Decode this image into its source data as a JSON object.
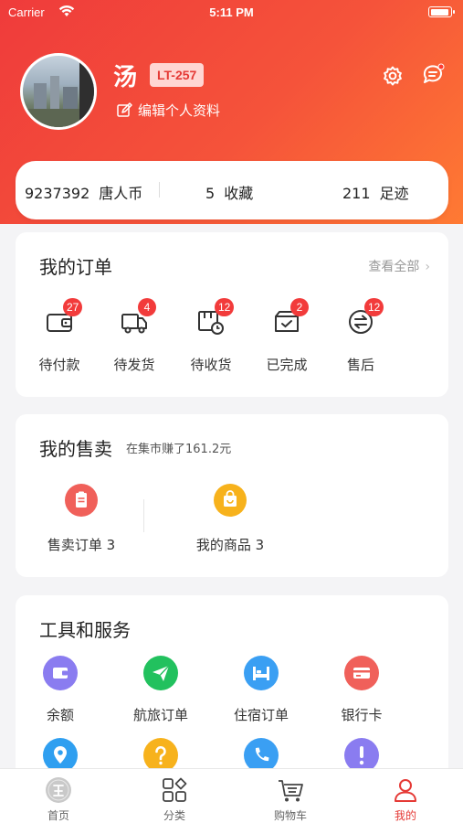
{
  "status_bar": {
    "carrier": "Carrier",
    "time": "5:11 PM"
  },
  "profile": {
    "name": "汤",
    "tag": "LT-257",
    "edit_label": "编辑个人资料"
  },
  "stats": [
    {
      "value": "9237392",
      "label": "唐人币"
    },
    {
      "value": "5",
      "label": "收藏"
    },
    {
      "value": "211",
      "label": "足迹"
    }
  ],
  "orders": {
    "title": "我的订单",
    "view_all": "查看全部",
    "items": [
      {
        "label": "待付款",
        "badge": "27",
        "icon": "wallet-icon"
      },
      {
        "label": "待发货",
        "badge": "4",
        "icon": "truck-icon"
      },
      {
        "label": "待收货",
        "badge": "12",
        "icon": "package-clock-icon"
      },
      {
        "label": "已完成",
        "badge": "2",
        "icon": "box-check-icon"
      },
      {
        "label": "售后",
        "badge": "12",
        "icon": "exchange-icon"
      }
    ]
  },
  "sales": {
    "title": "我的售卖",
    "subtitle": "在集市赚了161.2元",
    "items": [
      {
        "label": "售卖订单 3",
        "icon": "clipboard-icon",
        "color": "#f0605a"
      },
      {
        "label": "我的商品 3",
        "icon": "shopping-bag-icon",
        "color": "#f7b21c"
      }
    ]
  },
  "tools": {
    "title": "工具和服务",
    "items": [
      {
        "label": "余额",
        "icon": "wallet-icon",
        "color": "#8a7cf0"
      },
      {
        "label": "航旅订单",
        "icon": "paper-plane-icon",
        "color": "#22c15e"
      },
      {
        "label": "住宿订单",
        "icon": "bed-icon",
        "color": "#3a9ff3"
      },
      {
        "label": "银行卡",
        "icon": "bank-card-icon",
        "color": "#f0605a"
      },
      {
        "label": "",
        "icon": "location-pin-icon",
        "color": "#2f9ff0"
      },
      {
        "label": "",
        "icon": "help-icon",
        "color": "#f7b21c"
      },
      {
        "label": "",
        "icon": "phone-icon",
        "color": "#3a9ff3"
      },
      {
        "label": "",
        "icon": "alert-icon",
        "color": "#8a7cf0"
      }
    ]
  },
  "tabbar": [
    {
      "label": "首页",
      "icon": "home-logo-icon"
    },
    {
      "label": "分类",
      "icon": "category-grid-icon"
    },
    {
      "label": "购物车",
      "icon": "cart-icon"
    },
    {
      "label": "我的",
      "icon": "user-icon",
      "active": true
    }
  ],
  "colors": {
    "accent": "#e53935",
    "header_start": "#ef3b3b",
    "header_end": "#ff7a33"
  }
}
